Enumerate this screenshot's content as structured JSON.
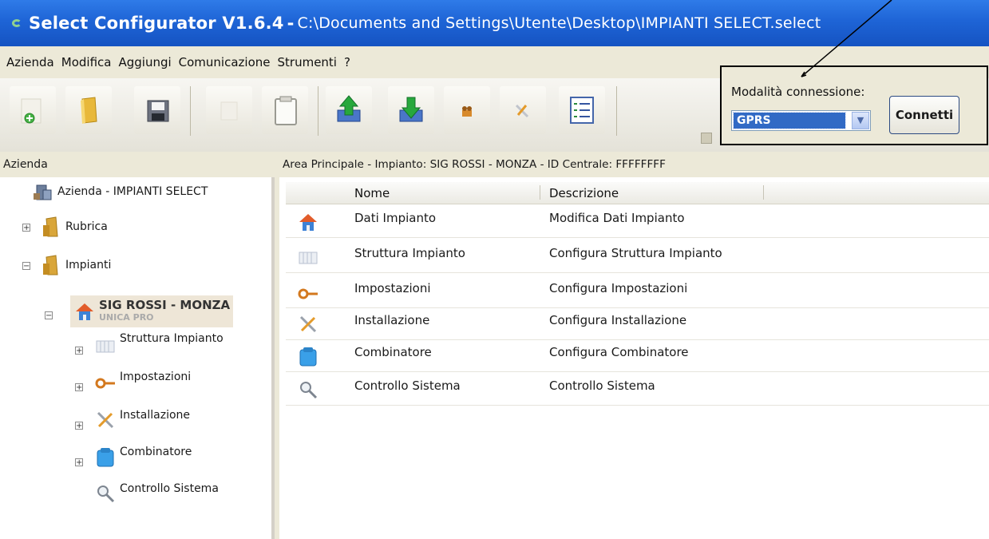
{
  "window": {
    "title_app": "Select Configurator V1.6.4",
    "title_sep": "-",
    "title_path": "C:\\Documents and Settings\\Utente\\Desktop\\IMPIANTI SELECT.select"
  },
  "menu": [
    "Azienda",
    "Modifica",
    "Aggiungi",
    "Comunicazione",
    "Strumenti",
    "?"
  ],
  "toolbar": {
    "buttons": [
      "new-icon",
      "open-folder-icon",
      "save-icon",
      "cut-icon",
      "paste-icon",
      "upload-icon",
      "download-icon",
      "users-icon",
      "tools-icon",
      "checklist-icon"
    ]
  },
  "connection": {
    "label": "Modalità connessione:",
    "mode": "GPRS",
    "connect_label": "Connetti"
  },
  "tree": {
    "header": "Azienda",
    "company": "Azienda - IMPIANTI SELECT",
    "rubrica": "Rubrica",
    "impianti": "Impianti",
    "selected": {
      "name": "SIG ROSSI - MONZA",
      "model": "UNICA PRO"
    },
    "children": [
      "Struttura Impianto",
      "Impostazioni",
      "Installazione",
      "Combinatore",
      "Controllo Sistema"
    ]
  },
  "main": {
    "header": "Area Principale - Impianto: SIG ROSSI - MONZA - ID Centrale: FFFFFFFF",
    "columns": {
      "name": "Nome",
      "description": "Descrizione"
    },
    "rows": [
      {
        "name": "Dati Impianto",
        "description": "Modifica Dati Impianto",
        "icon": "house-icon"
      },
      {
        "name": "Struttura Impianto",
        "description": "Configura Struttura Impianto",
        "icon": "structure-icon"
      },
      {
        "name": "Impostazioni",
        "description": "Configura Impostazioni",
        "icon": "key-icon"
      },
      {
        "name": "Installazione",
        "description": "Configura Installazione",
        "icon": "tools-icon"
      },
      {
        "name": "Combinatore",
        "description": "Configura Combinatore",
        "icon": "phone-icon"
      },
      {
        "name": "Controllo Sistema",
        "description": "Controllo Sistema",
        "icon": "magnifier-icon"
      }
    ]
  },
  "colors": {
    "titlebar": "#1e64d6",
    "selection": "#316ac5",
    "chrome": "#ece9d8"
  }
}
